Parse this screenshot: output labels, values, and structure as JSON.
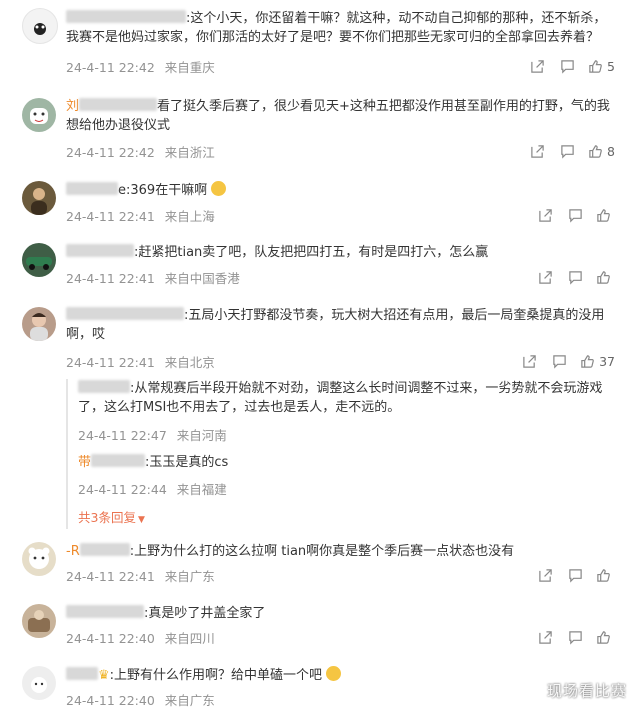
{
  "comments": [
    {
      "prefix": "",
      "text": ":这个小天，你还留着干嘛？就这种，动不动自己抑郁的那种，还不斩杀，我赛不是他妈过家家，你们那活的太好了是吧？要不你们把那些无家可归的全部拿回去养着？",
      "date": "24-4-11 22:42",
      "location": "来自重庆",
      "likes": "5",
      "avatar_color": "#f3f3f3"
    },
    {
      "prefix": "刘",
      "text": "看了挺久季后赛了，很少看见天+这种五把都没作用甚至副作用的打野，气的我想给他办退役仪式",
      "date": "24-4-11 22:42",
      "location": "来自浙江",
      "likes": "8",
      "avatar_color": "#9fb6a4"
    },
    {
      "prefix": "",
      "text": "e:369在干嘛啊",
      "date": "24-4-11 22:41",
      "location": "来自上海",
      "likes": "",
      "avatar_color": "#6b5a3c"
    },
    {
      "prefix": "",
      "text": ":赶紧把tian卖了吧，队友把把四打五，有时是四打六，怎么赢",
      "date": "24-4-11 22:41",
      "location": "来自中国香港",
      "likes": "",
      "avatar_color": "#3f5e46"
    },
    {
      "prefix": "",
      "text": ":五局小天打野都没节奏，玩大树大招还有点用，最后一局奎桑提真的没用啊，哎",
      "date": "24-4-11 22:41",
      "location": "来自北京",
      "likes": "37",
      "avatar_color": "#b89c8a"
    },
    {
      "prefix": "",
      "text": ":上野为什么打的这么拉啊 tian啊你真是整个季后赛一点状态也没有",
      "date": "24-4-11 22:41",
      "location": "来自广东",
      "likes": "",
      "avatar_color": "#e6ddc8"
    },
    {
      "prefix": "",
      "text": ":真是吵了井盖全家了",
      "date": "24-4-11 22:40",
      "location": "来自四川",
      "likes": "",
      "avatar_color": "#c8b39a"
    },
    {
      "prefix": "",
      "text": ":上野有什么作用啊？给中单磕一个吧",
      "date": "24-4-11 22:40",
      "location": "来自广东",
      "likes": "",
      "avatar_color": "#eeeeee"
    }
  ],
  "replies": [
    {
      "text": ":从常规赛后半段开始就不对劲，调整这么长时间调整不过来，一劣势就不会玩游戏了，这么打MSI也不用去了，过去也是丢人，走不远的。",
      "date": "24-4-11 22:47",
      "location": "来自河南"
    },
    {
      "text": ":玉玉是真的cs",
      "date": "24-4-11 22:44",
      "location": "来自福建"
    }
  ],
  "more_replies_label": "共3条回复",
  "watermark": "现场看比赛",
  "colors": {
    "link": "#eb7350",
    "meta": "#939393"
  }
}
